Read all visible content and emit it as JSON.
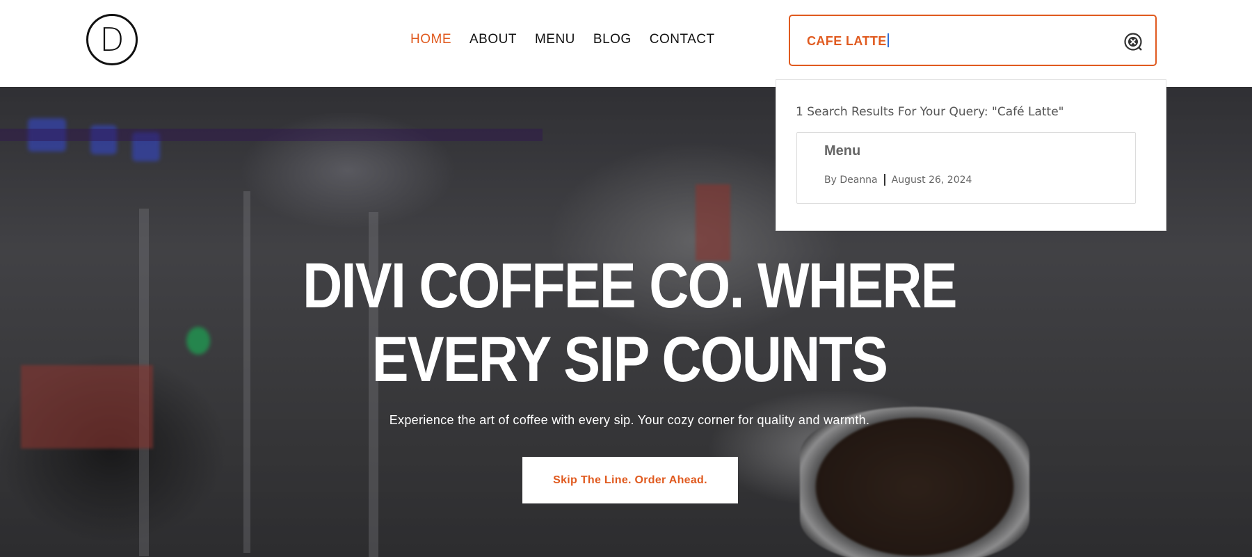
{
  "header": {
    "logo_letter": "D",
    "nav": [
      {
        "label": "HOME",
        "active": true
      },
      {
        "label": "ABOUT",
        "active": false
      },
      {
        "label": "MENU",
        "active": false
      },
      {
        "label": "BLOG",
        "active": false
      },
      {
        "label": "CONTACT",
        "active": false
      }
    ],
    "search": {
      "value": "CAFE LATTE",
      "clear_icon": "clear-search-icon"
    }
  },
  "search_results": {
    "heading": "1 Search Results For Your Query: \"Café Latte\"",
    "items": [
      {
        "title": "Menu",
        "author": "By Deanna",
        "date": "August 26, 2024"
      }
    ]
  },
  "hero": {
    "title_line1": "DIVI COFFEE CO. WHERE",
    "title_line2": "EVERY SIP COUNTS",
    "subtitle": "Experience the art of coffee with every sip. Your cozy corner for quality and warmth.",
    "cta_label": "Skip The Line. Order Ahead."
  },
  "colors": {
    "accent": "#e05a1f",
    "text_dark": "#111111",
    "white": "#ffffff"
  }
}
